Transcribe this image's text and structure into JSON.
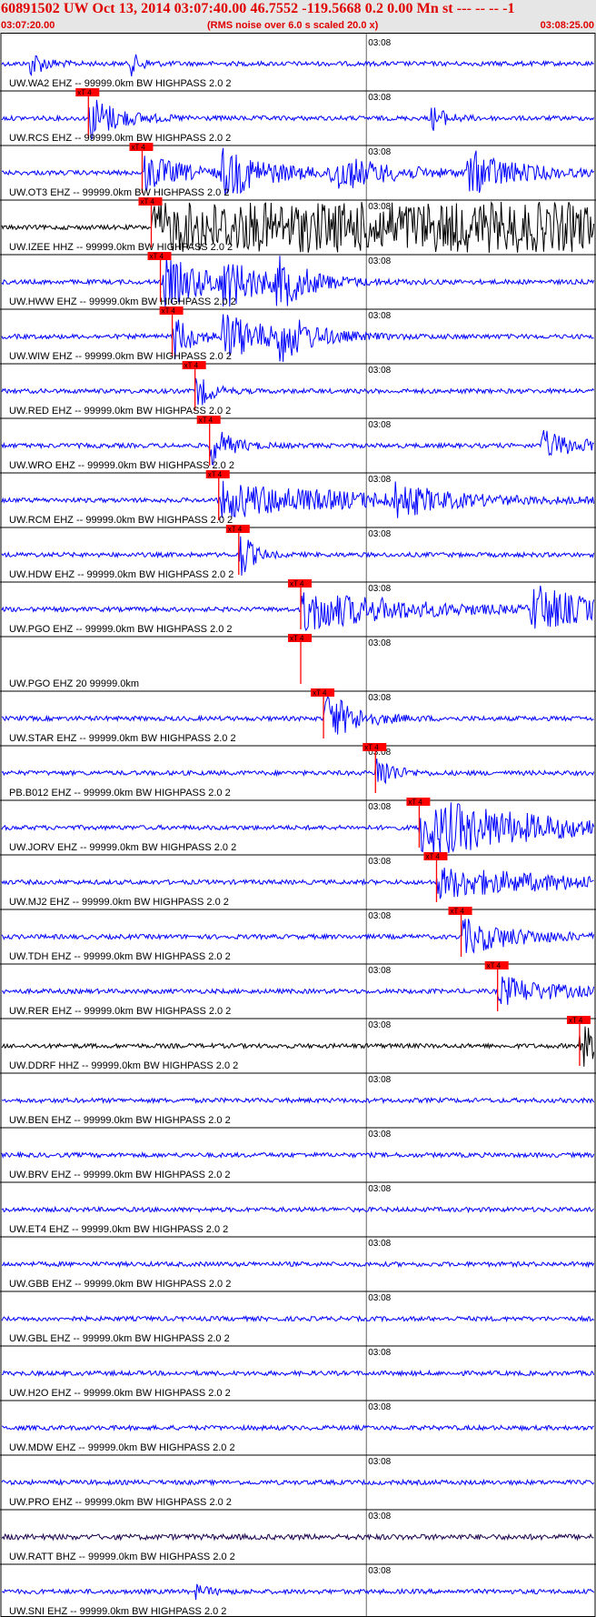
{
  "header": {
    "title": "60891502 UW Oct 13, 2014 03:07:40.00   46.7552 -119.5668  0.2 0.00 Mn st --- -- --   -1",
    "start_time": "03:07:20.00",
    "subtitle": "(RMS noise over 6.0 s scaled 20.0 x)",
    "end_time": "03:08:25.00"
  },
  "colors": {
    "trace": "#0000ff",
    "trace_black": "#000000",
    "trace_purple": "#1a004d",
    "pick": "#ff0000",
    "pick_box": "#ff0000",
    "grid": "#000000"
  },
  "chart_data": {
    "type": "line",
    "x_axis": {
      "unit": "seconds",
      "start": "03:07:20.00",
      "end": "03:08:25.00",
      "tick_label": "03:08",
      "tick_time_s": 40
    },
    "pick_label": "xT 4",
    "traces": [
      {
        "label": "UW.WA2 EHZ -- 99999.0km BW  HIGHPASS  2.0  2",
        "color": "blue",
        "pick": null
      },
      {
        "label": "UW.RCS EHZ -- 99999.0km BW  HIGHPASS  2.0  2",
        "color": "blue",
        "pick": 9.5
      },
      {
        "label": "UW.OT3 EHZ -- 99999.0km BW  HIGHPASS  2.0  2",
        "color": "blue",
        "pick": 15.4
      },
      {
        "label": "UW.IZEE HHZ -- 99999.0km BW  HIGHPASS  2.0  2",
        "color": "black",
        "pick": 16.4
      },
      {
        "label": "UW.HWW EHZ -- 99999.0km BW  HIGHPASS  2.0  2",
        "color": "blue",
        "pick": 17.4
      },
      {
        "label": "UW.WIW EHZ -- 99999.0km BW  HIGHPASS  2.0  2",
        "color": "blue",
        "pick": 18.7
      },
      {
        "label": "UW.RED EHZ -- 99999.0km BW  HIGHPASS  2.0  2",
        "color": "blue",
        "pick": 21.2
      },
      {
        "label": "UW.WRO EHZ -- 99999.0km BW  HIGHPASS  2.0  2",
        "color": "blue",
        "pick": 22.8
      },
      {
        "label": "UW.RCM EHZ -- 99999.0km BW  HIGHPASS  2.0  2",
        "color": "blue",
        "pick": 23.8
      },
      {
        "label": "UW.HDW EHZ -- 99999.0km BW  HIGHPASS  2.0  2",
        "color": "blue",
        "pick": 26.0
      },
      {
        "label": "UW.PGO EHZ -- 99999.0km BW  HIGHPASS  2.0  2",
        "color": "blue",
        "pick": 32.8
      },
      {
        "label": "UW.PGO EHZ 20 99999.0km",
        "color": "none",
        "pick": 32.8
      },
      {
        "label": "UW.STAR EHZ -- 99999.0km BW  HIGHPASS  2.0  2",
        "color": "blue",
        "pick": 35.3
      },
      {
        "label": "PB.B012 EHZ -- 99999.0km BW  HIGHPASS  2.0  2",
        "color": "blue",
        "pick": 41.0
      },
      {
        "label": "UW.JORV EHZ -- 99999.0km BW  HIGHPASS  2.0  2",
        "color": "blue",
        "pick": 45.8
      },
      {
        "label": "UW.MJ2 EHZ -- 99999.0km BW  HIGHPASS  2.0  2",
        "color": "blue",
        "pick": 47.7
      },
      {
        "label": "UW.TDH EHZ -- 99999.0km BW  HIGHPASS  2.0  2",
        "color": "blue",
        "pick": 50.4
      },
      {
        "label": "UW.RER EHZ -- 99999.0km BW  HIGHPASS  2.0  2",
        "color": "blue",
        "pick": 54.4
      },
      {
        "label": "UW.DDRF HHZ -- 99999.0km BW  HIGHPASS  2.0  2",
        "color": "black",
        "pick": 63.4
      },
      {
        "label": "UW.BEN EHZ -- 99999.0km BW  HIGHPASS  2.0  2",
        "color": "blue",
        "pick": null
      },
      {
        "label": "UW.BRV EHZ -- 99999.0km BW  HIGHPASS  2.0  2",
        "color": "blue",
        "pick": null
      },
      {
        "label": "UW.ET4 EHZ -- 99999.0km BW  HIGHPASS  2.0  2",
        "color": "blue",
        "pick": null
      },
      {
        "label": "UW.GBB EHZ -- 99999.0km BW  HIGHPASS  2.0  2",
        "color": "blue",
        "pick": null
      },
      {
        "label": "UW.GBL EHZ -- 99999.0km BW  HIGHPASS  2.0  2",
        "color": "blue",
        "pick": null
      },
      {
        "label": "UW.H2O EHZ -- 99999.0km BW  HIGHPASS  2.0  2",
        "color": "blue",
        "pick": null
      },
      {
        "label": "UW.MDW EHZ -- 99999.0km BW  HIGHPASS  2.0  2",
        "color": "blue",
        "pick": null
      },
      {
        "label": "UW.PRO EHZ -- 99999.0km BW  HIGHPASS  2.0  2",
        "color": "blue",
        "pick": null
      },
      {
        "label": "UW.RATT BHZ -- 99999.0km BW  HIGHPASS  2.0  2",
        "color": "purple",
        "pick": null
      },
      {
        "label": "UW.SNI EHZ -- 99999.0km BW  HIGHPASS  2.0  2",
        "color": "blue",
        "pick": null
      }
    ]
  }
}
